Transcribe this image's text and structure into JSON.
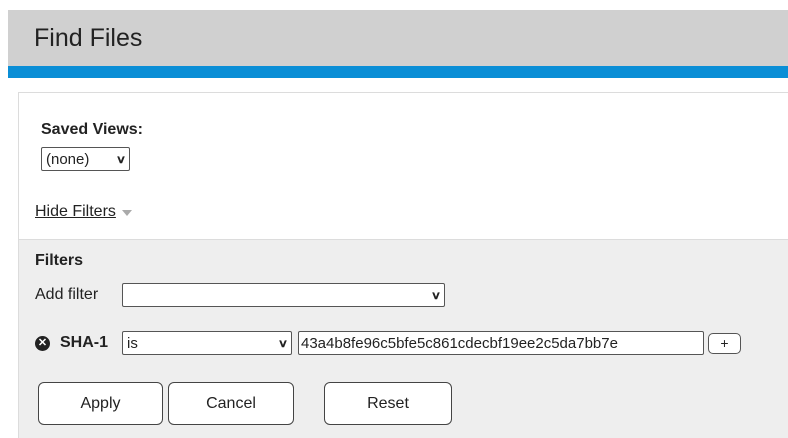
{
  "page": {
    "title": "Find Files"
  },
  "saved_views": {
    "label": "Saved Views:",
    "selected": "(none)"
  },
  "toggle_filters": {
    "label": "Hide Filters"
  },
  "filters": {
    "heading": "Filters",
    "add_filter_label": "Add filter",
    "add_filter_selected": "",
    "rows": [
      {
        "field": "SHA-1",
        "operator": "is",
        "value": "43a4b8fe96c5bfe5c861cdecbf19ee2c5da7bb7e",
        "add_label": "+"
      }
    ]
  },
  "buttons": {
    "apply": "Apply",
    "cancel": "Cancel",
    "reset": "Reset"
  },
  "icons": {
    "remove": "close-circle-icon",
    "dropdown": "chevron-down-icon",
    "collapse": "triangle-down-icon"
  },
  "colors": {
    "header_bg": "#d0d0d0",
    "accent": "#0a8ed6",
    "filters_bg": "#eeeeee"
  }
}
